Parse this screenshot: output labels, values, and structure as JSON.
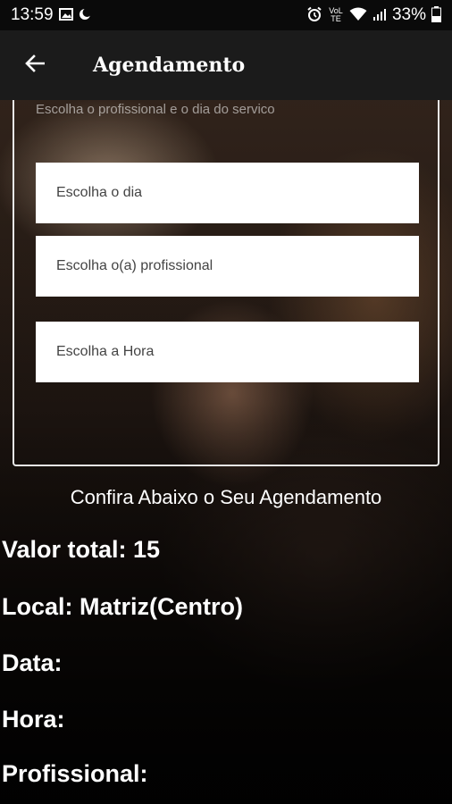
{
  "status_bar": {
    "time": "13:59",
    "battery": "33%",
    "volte": "VoLTE"
  },
  "app_bar": {
    "title": "Agendamento",
    "back_icon": "arrow-left-icon"
  },
  "form": {
    "subtitle": "Escolha o profissional e o dia do servico",
    "day_field": "Escolha o dia",
    "professional_field": "Escolha o(a) profissional",
    "hour_field": "Escolha a Hora"
  },
  "summary": {
    "heading": "Confira Abaixo o Seu Agendamento",
    "total": "Valor total: 15",
    "location": "Local: Matriz(Centro)",
    "date": "Data:",
    "hour": "Hora:",
    "professional": "Profissional:"
  }
}
